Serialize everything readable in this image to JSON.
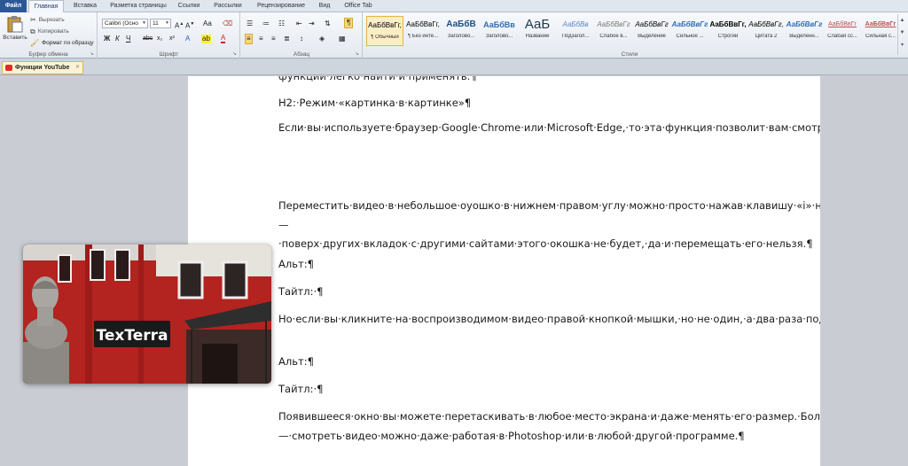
{
  "tabs": [
    "Файл",
    "Главная",
    "Вставка",
    "Разметка страницы",
    "Ссылки",
    "Рассылки",
    "Рецензирование",
    "Вид",
    "Office Tab"
  ],
  "clipboard": {
    "paste": "Вставить",
    "cut": "Вырезать",
    "copy": "Копировать",
    "format_painter": "Формат по образцу",
    "group": "Буфер обмена"
  },
  "font": {
    "name": "Calibri (Осно",
    "size": "11",
    "group": "Шрифт"
  },
  "paragraph": {
    "group": "Абзац"
  },
  "styles": {
    "group": "Стили",
    "items": [
      {
        "preview": "АаБбВвГг,",
        "name": "¶ Обычный"
      },
      {
        "preview": "АаБбВвГг,",
        "name": "¶ Без инте..."
      },
      {
        "preview": "АаБбВ",
        "name": "Заголово..."
      },
      {
        "preview": "АаБбВв",
        "name": "Заголово..."
      },
      {
        "preview": "АаБ",
        "name": "Название"
      },
      {
        "preview": "АаБбВв",
        "name": "Подзагол..."
      },
      {
        "preview": "АаБбВвГг",
        "name": "Слабое в..."
      },
      {
        "preview": "АаБбВвГг",
        "name": "Выделение"
      },
      {
        "preview": "АаБбВвГг",
        "name": "Сильное ..."
      },
      {
        "preview": "АаБбВвГг,",
        "name": "Строгий"
      },
      {
        "preview": "АаБбВвГг,",
        "name": "Цитата 2"
      },
      {
        "preview": "АаБбВвГг",
        "name": "Выделенн..."
      },
      {
        "preview": "АаБбВвГг",
        "name": "Слабая сс..."
      },
      {
        "preview": "АаБбВвГг",
        "name": "Сильная с..."
      }
    ]
  },
  "document_tab": "Функции YouTube",
  "document": {
    "clipped_line": "функции·легко·найти·и·применять.¶",
    "heading": "H2:·Режим·«картинка·в·картинке»¶",
    "p1": "Если·вы·используете·браузер·Google·Chrome·или·Microsoft·Edge,·то·эта·функция·позволит·вам·смотреть·видео·в·небольшом·окне,·которое·вы·сможете·перемещать·в·любую·точку·экрана.·Благодаря·этому·вы·одновременно·сможете·листать·новостные·ленты,·соцсети,·изучать·сайты,·пользоваться·поиском·и·посматривать·видео.¶",
    "p2": "Переместить·видео·в·небольшое·оуошко·в·нижнем·правом·углу·можно·просто·нажав·клавишу·«i»·на·клавиатуре,·но·это·позволит·лишь·листать·сам·Youtube·—·поверх·других·вкладок·с·другими·сайтами·этого·окошка·не·будет,·да·и·перемещать·его·нельзя.¶",
    "alt1": "Альт:¶",
    "title1": "Тайтл:·¶",
    "p3": "Но·если·вы·кликните·на·воспроизводимом·видео·правой·кнопкой·мышки,·но·не·один,·а·два·раза·подряд·(скорость·клика·неважна),·то·появится·меню,·которое·вы,·возможно,·никогда·не·видели:¶",
    "alt2": "Альт:¶",
    "title2": "Тайтл:·¶",
    "p4": "Появившееся·окно·вы·можете·перетаскивать·в·любое·место·экрана·и·даже·менять·его·размер.·Более·того,·оно·будет·поверх·чего·угодно·—·смотреть·видео·можно·даже·работая·в·Photoshop·или·в·любой·другой·программе.¶"
  },
  "picture": {
    "sign_text": "TexTerra"
  },
  "colors": {
    "file_tab": "#2b5797",
    "selected_style": "#fbeec4",
    "building_red": "#b3231f",
    "heading_blue": "#1f4e8c"
  }
}
